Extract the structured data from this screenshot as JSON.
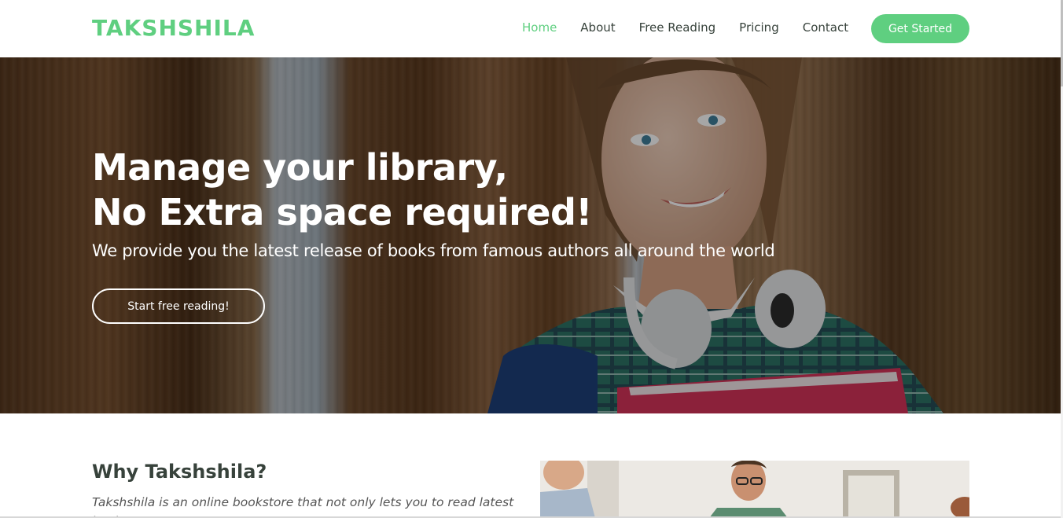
{
  "header": {
    "logo": "TAKSHSHILA",
    "nav": [
      {
        "label": "Home",
        "active": true
      },
      {
        "label": "About",
        "active": false
      },
      {
        "label": "Free Reading",
        "active": false
      },
      {
        "label": "Pricing",
        "active": false
      },
      {
        "label": "Contact",
        "active": false
      }
    ],
    "cta_label": "Get Started"
  },
  "hero": {
    "title_line1": "Manage your library,",
    "title_line2": "No Extra space required!",
    "subtitle": "We provide you the latest release of books from famous authors all around the world",
    "button_label": "Start free reading!"
  },
  "about": {
    "title": "Why Takshshila?",
    "text": "Takshshila is an online bookstore that not only lets you to read latest books"
  },
  "colors": {
    "accent": "#5fcf80",
    "nav_text": "#37423b"
  }
}
